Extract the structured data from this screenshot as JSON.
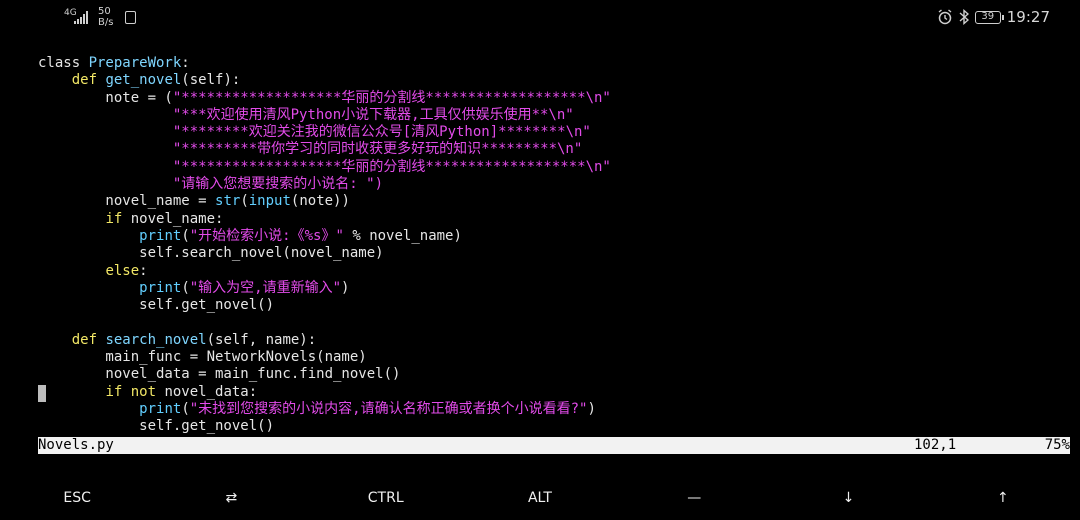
{
  "status_bar": {
    "network_type": "4G",
    "speed_value": "50",
    "speed_unit": "B/s",
    "battery_level": "39",
    "time": "19:27"
  },
  "editor": {
    "lines": [
      [
        {
          "t": "class ",
          "c": "plain"
        },
        {
          "t": "PrepareWork",
          "c": "fn"
        },
        {
          "t": ":",
          "c": "plain"
        }
      ],
      [
        {
          "t": "    ",
          "c": "plain"
        },
        {
          "t": "def ",
          "c": "kw"
        },
        {
          "t": "get_novel",
          "c": "fn"
        },
        {
          "t": "(self):",
          "c": "plain"
        }
      ],
      [
        {
          "t": "        note = (",
          "c": "plain"
        },
        {
          "t": "\"*******************华丽的分割线*******************\\n\"",
          "c": "str"
        }
      ],
      [
        {
          "t": "                ",
          "c": "plain"
        },
        {
          "t": "\"***欢迎使用清风Python小说下载器,工具仅供娱乐使用**\\n\"",
          "c": "str"
        }
      ],
      [
        {
          "t": "                ",
          "c": "plain"
        },
        {
          "t": "\"********欢迎关注我的微信公众号[清风Python]********\\n\"",
          "c": "str"
        }
      ],
      [
        {
          "t": "                ",
          "c": "plain"
        },
        {
          "t": "\"*********带你学习的同时收获更多好玩的知识*********\\n\"",
          "c": "str"
        }
      ],
      [
        {
          "t": "                ",
          "c": "plain"
        },
        {
          "t": "\"*******************华丽的分割线*******************\\n\"",
          "c": "str"
        }
      ],
      [
        {
          "t": "                ",
          "c": "plain"
        },
        {
          "t": "\"请输入您想要搜索的小说名: \")",
          "c": "str"
        }
      ],
      [
        {
          "t": "        novel_name = ",
          "c": "plain"
        },
        {
          "t": "str",
          "c": "bi"
        },
        {
          "t": "(",
          "c": "plain"
        },
        {
          "t": "input",
          "c": "bi"
        },
        {
          "t": "(note))",
          "c": "plain"
        }
      ],
      [
        {
          "t": "        ",
          "c": "plain"
        },
        {
          "t": "if ",
          "c": "kw"
        },
        {
          "t": "novel_name:",
          "c": "plain"
        }
      ],
      [
        {
          "t": "            ",
          "c": "plain"
        },
        {
          "t": "print",
          "c": "bi"
        },
        {
          "t": "(",
          "c": "plain"
        },
        {
          "t": "\"开始检索小说:《%s》\"",
          "c": "str"
        },
        {
          "t": " % novel_name)",
          "c": "plain"
        }
      ],
      [
        {
          "t": "            self.search_novel(novel_name)",
          "c": "plain"
        }
      ],
      [
        {
          "t": "        ",
          "c": "plain"
        },
        {
          "t": "else",
          "c": "kw"
        },
        {
          "t": ":",
          "c": "plain"
        }
      ],
      [
        {
          "t": "            ",
          "c": "plain"
        },
        {
          "t": "print",
          "c": "bi"
        },
        {
          "t": "(",
          "c": "plain"
        },
        {
          "t": "\"输入为空,请重新输入\"",
          "c": "str"
        },
        {
          "t": ")",
          "c": "plain"
        }
      ],
      [
        {
          "t": "            self.get_novel()",
          "c": "plain"
        }
      ],
      [
        {
          "t": "",
          "c": "plain"
        }
      ],
      [
        {
          "t": "    ",
          "c": "plain"
        },
        {
          "t": "def ",
          "c": "kw"
        },
        {
          "t": "search_novel",
          "c": "fn"
        },
        {
          "t": "(self, name):",
          "c": "plain"
        }
      ],
      [
        {
          "t": "        main_func = NetworkNovels(name)",
          "c": "plain"
        }
      ],
      [
        {
          "t": "        novel_data = main_func.find_novel()",
          "c": "plain"
        }
      ],
      [
        {
          "t": "        ",
          "c": "plain"
        },
        {
          "t": "if not ",
          "c": "kw"
        },
        {
          "t": "novel_data:",
          "c": "plain"
        }
      ],
      [
        {
          "t": "            ",
          "c": "plain"
        },
        {
          "t": "print",
          "c": "bi"
        },
        {
          "t": "(",
          "c": "plain"
        },
        {
          "t": "\"未找到您搜索的小说内容,请确认名称正确或者换个小说看看?\"",
          "c": "str"
        },
        {
          "t": ")",
          "c": "plain"
        }
      ],
      [
        {
          "t": "            self.get_novel()",
          "c": "plain"
        }
      ]
    ]
  },
  "vim_status": {
    "filename": "Novels.py",
    "position": "102,1",
    "percent": "75%"
  },
  "extra_keys": [
    "ESC",
    "⇄",
    "CTRL",
    "ALT",
    "—",
    "↓",
    "↑"
  ]
}
